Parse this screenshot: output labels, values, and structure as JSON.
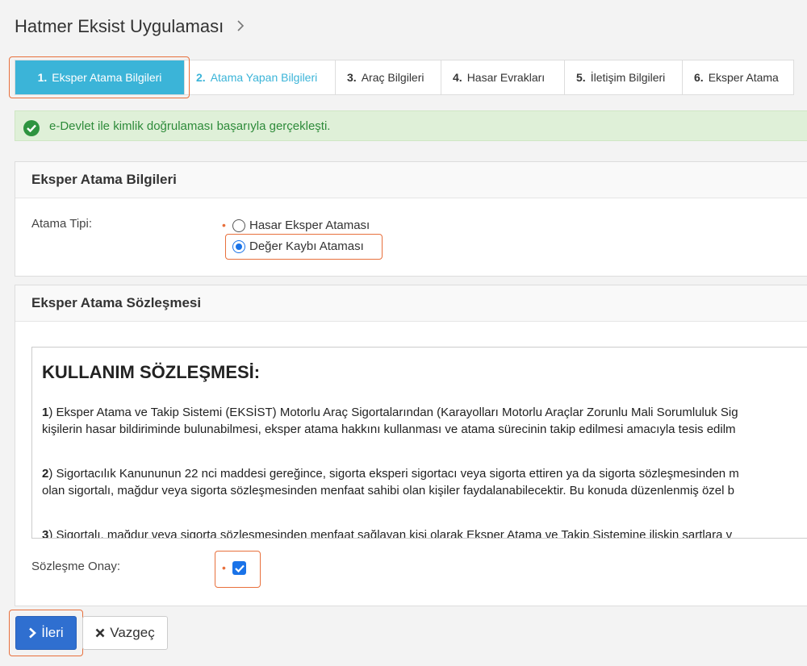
{
  "header": {
    "title": "Hatmer Eksist Uygulaması"
  },
  "steps": [
    {
      "num": "1.",
      "label": "Eksper Atama Bilgileri",
      "state": "active"
    },
    {
      "num": "2.",
      "label": "Atama Yapan Bilgileri",
      "state": "next"
    },
    {
      "num": "3.",
      "label": "Araç Bilgileri",
      "state": ""
    },
    {
      "num": "4.",
      "label": "Hasar Evrakları",
      "state": ""
    },
    {
      "num": "5.",
      "label": "İletişim Bilgileri",
      "state": ""
    },
    {
      "num": "6.",
      "label": "Eksper Atama",
      "state": ""
    }
  ],
  "alert": {
    "text": "e-Devlet ile kimlik doğrulaması başarıyla gerçekleşti."
  },
  "assignment_panel": {
    "title": "Eksper Atama Bilgileri",
    "field_label": "Atama Tipi:",
    "options": [
      {
        "label": "Hasar Eksper Ataması",
        "checked": false
      },
      {
        "label": "Değer Kaybı Ataması",
        "checked": true
      }
    ]
  },
  "contract_panel": {
    "title": "Eksper Atama Sözleşmesi",
    "doc_title": "KULLANIM SÖZLEŞMESİ:",
    "clauses": [
      {
        "num": "1",
        "line1": ") Eksper Atama ve Takip Sistemi (EKSİST) Motorlu Araç Sigortalarından (Karayolları Motorlu Araçlar Zorunlu Mali Sorumluluk Sig",
        "line2": "kişilerin hasar bildiriminde bulunabilmesi, eksper atama hakkını kullanması ve atama sürecinin takip edilmesi amacıyla tesis edilm"
      },
      {
        "num": "2",
        "line1": ") Sigortacılık Kanununun 22 nci maddesi gereğince, sigorta eksperi sigortacı veya sigorta ettiren ya da sigorta sözleşmesinden m",
        "line2": "olan sigortalı, mağdur veya sigorta sözleşmesinden menfaat sahibi olan kişiler faydalanabilecektir. Bu konuda düzenlenmiş özel b"
      },
      {
        "num": "3",
        "line1": ") Sigortalı, mağdur veya sigorta sözleşmesinden menfaat sağlayan kişi olarak Eksper Atama ve Takip Sistemine ilişkin şartlara v",
        "line2": ""
      }
    ],
    "approve_label": "Sözleşme Onay:",
    "approved": true
  },
  "buttons": {
    "next_label": "İleri",
    "cancel_label": "Vazgeç"
  },
  "colors": {
    "accent": "#3bb4d8",
    "primary": "#2f6fd0",
    "highlight": "#e8703c",
    "success_bg": "#dff0d8"
  }
}
